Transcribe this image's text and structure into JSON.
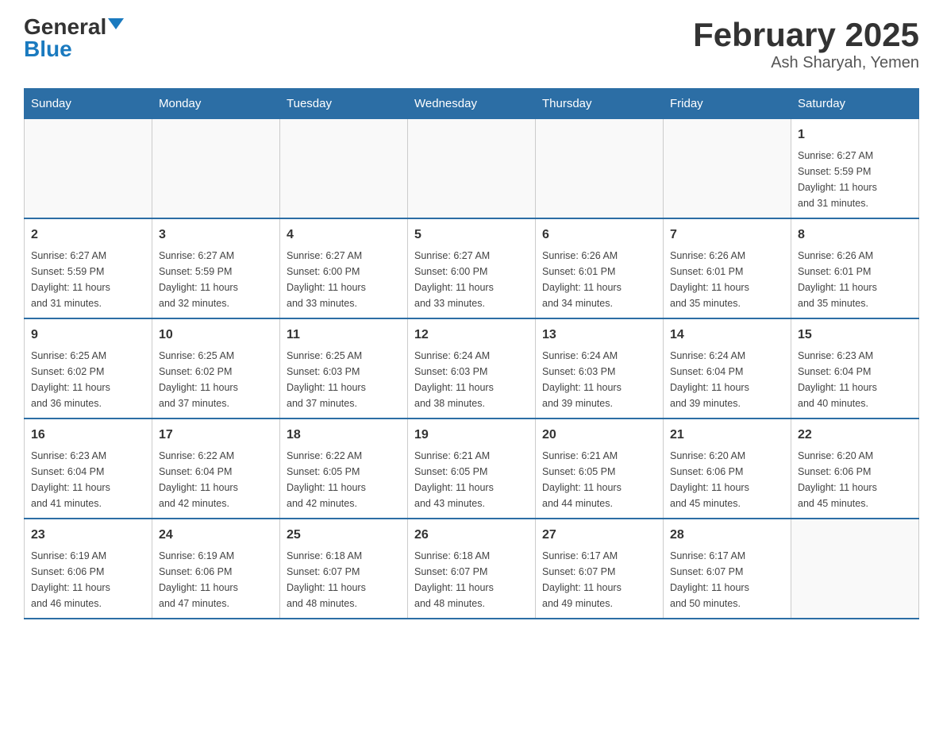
{
  "header": {
    "logo_general": "General",
    "logo_blue": "Blue",
    "month_title": "February 2025",
    "location": "Ash Sharyah, Yemen"
  },
  "days_of_week": [
    "Sunday",
    "Monday",
    "Tuesday",
    "Wednesday",
    "Thursday",
    "Friday",
    "Saturday"
  ],
  "weeks": [
    [
      {
        "num": "",
        "info": ""
      },
      {
        "num": "",
        "info": ""
      },
      {
        "num": "",
        "info": ""
      },
      {
        "num": "",
        "info": ""
      },
      {
        "num": "",
        "info": ""
      },
      {
        "num": "",
        "info": ""
      },
      {
        "num": "1",
        "info": "Sunrise: 6:27 AM\nSunset: 5:59 PM\nDaylight: 11 hours\nand 31 minutes."
      }
    ],
    [
      {
        "num": "2",
        "info": "Sunrise: 6:27 AM\nSunset: 5:59 PM\nDaylight: 11 hours\nand 31 minutes."
      },
      {
        "num": "3",
        "info": "Sunrise: 6:27 AM\nSunset: 5:59 PM\nDaylight: 11 hours\nand 32 minutes."
      },
      {
        "num": "4",
        "info": "Sunrise: 6:27 AM\nSunset: 6:00 PM\nDaylight: 11 hours\nand 33 minutes."
      },
      {
        "num": "5",
        "info": "Sunrise: 6:27 AM\nSunset: 6:00 PM\nDaylight: 11 hours\nand 33 minutes."
      },
      {
        "num": "6",
        "info": "Sunrise: 6:26 AM\nSunset: 6:01 PM\nDaylight: 11 hours\nand 34 minutes."
      },
      {
        "num": "7",
        "info": "Sunrise: 6:26 AM\nSunset: 6:01 PM\nDaylight: 11 hours\nand 35 minutes."
      },
      {
        "num": "8",
        "info": "Sunrise: 6:26 AM\nSunset: 6:01 PM\nDaylight: 11 hours\nand 35 minutes."
      }
    ],
    [
      {
        "num": "9",
        "info": "Sunrise: 6:25 AM\nSunset: 6:02 PM\nDaylight: 11 hours\nand 36 minutes."
      },
      {
        "num": "10",
        "info": "Sunrise: 6:25 AM\nSunset: 6:02 PM\nDaylight: 11 hours\nand 37 minutes."
      },
      {
        "num": "11",
        "info": "Sunrise: 6:25 AM\nSunset: 6:03 PM\nDaylight: 11 hours\nand 37 minutes."
      },
      {
        "num": "12",
        "info": "Sunrise: 6:24 AM\nSunset: 6:03 PM\nDaylight: 11 hours\nand 38 minutes."
      },
      {
        "num": "13",
        "info": "Sunrise: 6:24 AM\nSunset: 6:03 PM\nDaylight: 11 hours\nand 39 minutes."
      },
      {
        "num": "14",
        "info": "Sunrise: 6:24 AM\nSunset: 6:04 PM\nDaylight: 11 hours\nand 39 minutes."
      },
      {
        "num": "15",
        "info": "Sunrise: 6:23 AM\nSunset: 6:04 PM\nDaylight: 11 hours\nand 40 minutes."
      }
    ],
    [
      {
        "num": "16",
        "info": "Sunrise: 6:23 AM\nSunset: 6:04 PM\nDaylight: 11 hours\nand 41 minutes."
      },
      {
        "num": "17",
        "info": "Sunrise: 6:22 AM\nSunset: 6:04 PM\nDaylight: 11 hours\nand 42 minutes."
      },
      {
        "num": "18",
        "info": "Sunrise: 6:22 AM\nSunset: 6:05 PM\nDaylight: 11 hours\nand 42 minutes."
      },
      {
        "num": "19",
        "info": "Sunrise: 6:21 AM\nSunset: 6:05 PM\nDaylight: 11 hours\nand 43 minutes."
      },
      {
        "num": "20",
        "info": "Sunrise: 6:21 AM\nSunset: 6:05 PM\nDaylight: 11 hours\nand 44 minutes."
      },
      {
        "num": "21",
        "info": "Sunrise: 6:20 AM\nSunset: 6:06 PM\nDaylight: 11 hours\nand 45 minutes."
      },
      {
        "num": "22",
        "info": "Sunrise: 6:20 AM\nSunset: 6:06 PM\nDaylight: 11 hours\nand 45 minutes."
      }
    ],
    [
      {
        "num": "23",
        "info": "Sunrise: 6:19 AM\nSunset: 6:06 PM\nDaylight: 11 hours\nand 46 minutes."
      },
      {
        "num": "24",
        "info": "Sunrise: 6:19 AM\nSunset: 6:06 PM\nDaylight: 11 hours\nand 47 minutes."
      },
      {
        "num": "25",
        "info": "Sunrise: 6:18 AM\nSunset: 6:07 PM\nDaylight: 11 hours\nand 48 minutes."
      },
      {
        "num": "26",
        "info": "Sunrise: 6:18 AM\nSunset: 6:07 PM\nDaylight: 11 hours\nand 48 minutes."
      },
      {
        "num": "27",
        "info": "Sunrise: 6:17 AM\nSunset: 6:07 PM\nDaylight: 11 hours\nand 49 minutes."
      },
      {
        "num": "28",
        "info": "Sunrise: 6:17 AM\nSunset: 6:07 PM\nDaylight: 11 hours\nand 50 minutes."
      },
      {
        "num": "",
        "info": ""
      }
    ]
  ]
}
